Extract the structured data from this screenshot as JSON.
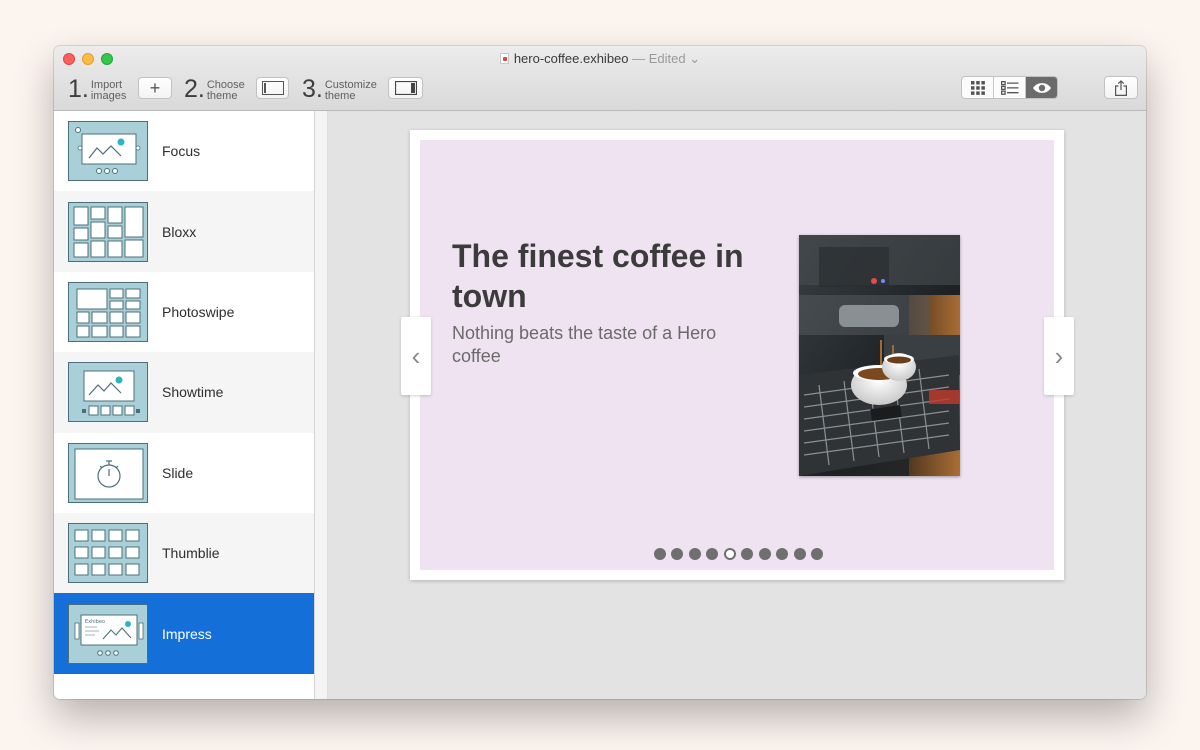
{
  "window": {
    "file_name": "hero-coffee.exhibeo",
    "edited_label": "— Edited",
    "edited_chevron": "⌄"
  },
  "toolbar": {
    "steps": [
      {
        "number": "1.",
        "label_line1": "Import",
        "label_line2": "images",
        "button_icon": "plus-icon"
      },
      {
        "number": "2.",
        "label_line1": "Choose",
        "label_line2": "theme",
        "button_icon": "sidebar-left-icon"
      },
      {
        "number": "3.",
        "label_line1": "Customize",
        "label_line2": "theme",
        "button_icon": "sidebar-right-icon"
      }
    ],
    "add_symbol": "+",
    "view_modes": [
      "grid-view-icon",
      "list-view-icon",
      "preview-eye-icon"
    ],
    "selected_view": "preview-eye-icon",
    "share_icon": "share-icon"
  },
  "sidebar": {
    "items": [
      {
        "label": "Focus",
        "thumb": "focus"
      },
      {
        "label": "Bloxx",
        "thumb": "bloxx"
      },
      {
        "label": "Photoswipe",
        "thumb": "photoswipe"
      },
      {
        "label": "Showtime",
        "thumb": "showtime"
      },
      {
        "label": "Slide",
        "thumb": "slide"
      },
      {
        "label": "Thumblie",
        "thumb": "thumblie"
      },
      {
        "label": "Impress",
        "thumb": "impress"
      }
    ],
    "selected": "Impress",
    "impress_thumb_caption": "Exhibeo"
  },
  "preview": {
    "headline": "The finest coffee in town",
    "subline": "Nothing beats the taste of a Hero coffee",
    "prev_arrow": "‹",
    "next_arrow": "›",
    "page_dots_total": 10,
    "page_dots_active": 5,
    "slide_background": "#efe3f2"
  },
  "colors": {
    "selection_blue": "#1470d8",
    "thumb_teal": "#a9d0d9",
    "accent_cyan": "#27b6c9"
  }
}
